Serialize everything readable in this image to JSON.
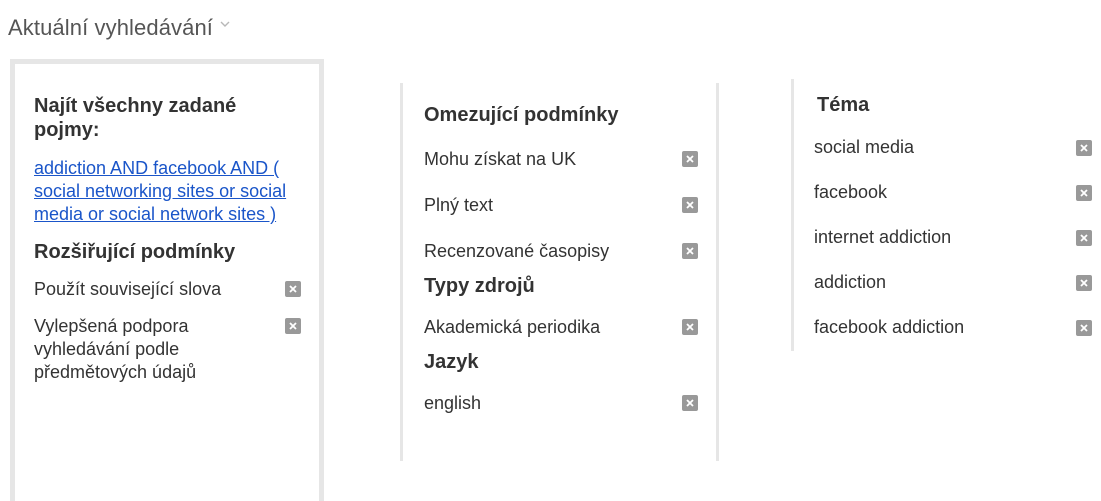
{
  "header": {
    "title": "Aktuální vyhledávání"
  },
  "query_panel": {
    "heading": "Najít všechny zadané pojmy:",
    "query": "addiction AND facebook AND ( social networking sites or social media or social network sites )",
    "expanders_heading": "Rozšiřující podmínky",
    "expanders": [
      {
        "label": "Použít související slova"
      },
      {
        "label": "Vylepšená podpora vyhledávání podle předmětových údajů"
      }
    ]
  },
  "limiters_panel": {
    "heading": "Omezující podmínky",
    "limiters": [
      {
        "label": "Mohu získat na UK"
      },
      {
        "label": "Plný text"
      },
      {
        "label": "Recenzované časopisy"
      }
    ],
    "source_types_heading": "Typy zdrojů",
    "source_types": [
      {
        "label": "Akademická periodika"
      }
    ],
    "language_heading": "Jazyk",
    "languages": [
      {
        "label": "english"
      }
    ]
  },
  "subject_panel": {
    "heading": "Téma",
    "subjects": [
      {
        "label": "social media"
      },
      {
        "label": "facebook"
      },
      {
        "label": "internet addiction"
      },
      {
        "label": "addiction"
      },
      {
        "label": "facebook addiction"
      }
    ]
  },
  "icons": {
    "remove": "close-icon",
    "collapse": "chevron-down-icon"
  },
  "colors": {
    "link": "#1a55c9",
    "remove_button": "#999999",
    "divider": "#e6e6e6",
    "text": "#333333"
  }
}
